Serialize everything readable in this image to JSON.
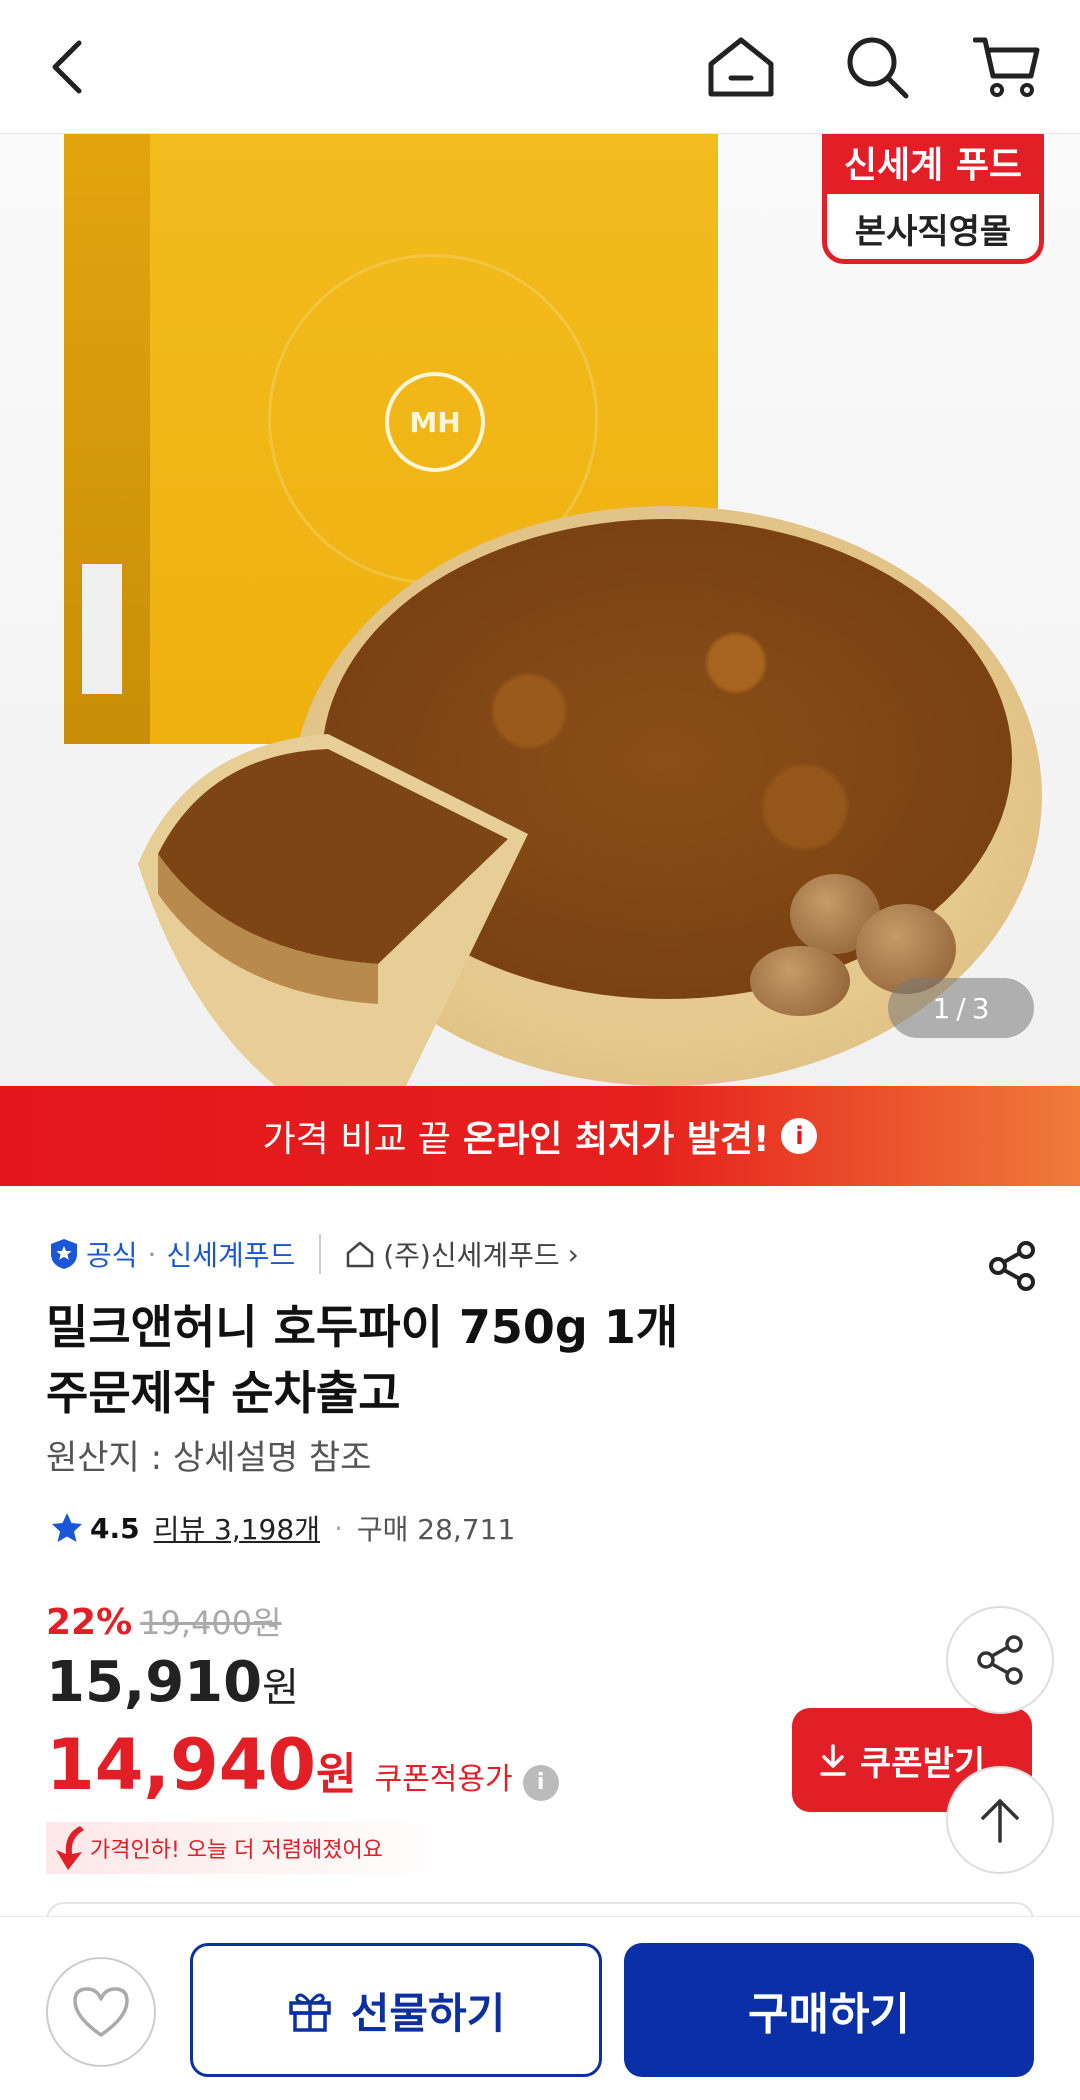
{
  "banner": {
    "prefix": "가격 비교 끝",
    "highlight": "온라인 최저가 발견!",
    "info_icon": "i"
  },
  "hero": {
    "brand_badge_top": "신세계 푸드",
    "brand_badge_bottom": "본사직영몰",
    "box_logo": "MH",
    "pager_current": "1",
    "pager_sep": "/",
    "pager_total": "3"
  },
  "seller": {
    "official": "공식",
    "dot": "·",
    "brand": "신세계푸드",
    "store": "(주)신세계푸드",
    "store_chevron": "›"
  },
  "product": {
    "title_line1": "밀크앤허니 호두파이 750g 1개",
    "title_line2": "주문제작 순차출고",
    "origin": "원산지 : 상세설명 참조",
    "rating": "4.5",
    "reviews": "리뷰 3,198개",
    "sep": "·",
    "purchases": "구매 28,711"
  },
  "price": {
    "discount_pct": "22%",
    "original": "19,400원",
    "sale": "15,910",
    "sale_unit": "원",
    "coupon": "14,940",
    "coupon_unit": "원",
    "coupon_label": "쿠폰적용가",
    "coupon_info": "i",
    "price_down_note": "가격인하! 오늘 더 저렴해졌어요"
  },
  "buttons": {
    "coupon": "쿠폰받기",
    "gift": "선물하기",
    "buy": "구매하기"
  },
  "colors": {
    "accent_red": "#e21f26",
    "brand_blue": "#0a2fa6",
    "link_blue": "#1a56d6"
  },
  "icons": [
    "back-icon",
    "home-icon",
    "search-icon",
    "cart-icon",
    "share-icon",
    "star-icon",
    "heart-icon",
    "gift-icon",
    "download-icon",
    "arrow-up-icon",
    "shield-check-icon",
    "store-icon"
  ]
}
